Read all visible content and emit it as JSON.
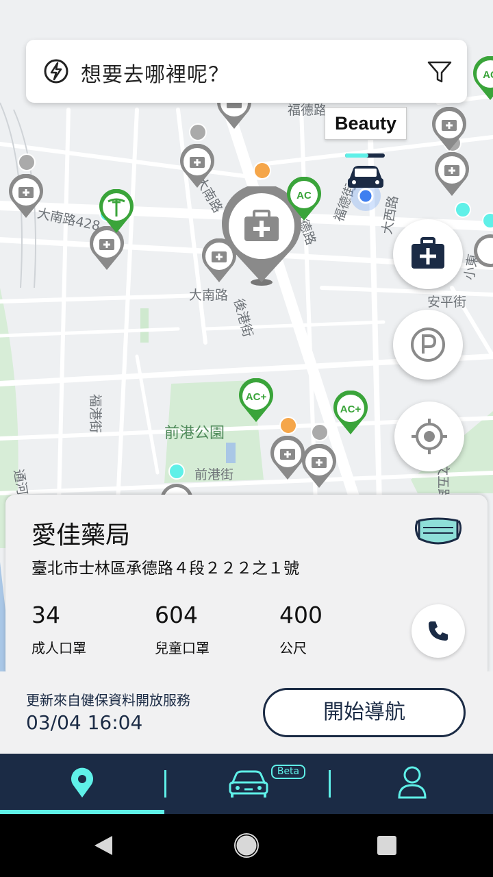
{
  "search": {
    "placeholder": "想要去哪裡呢？"
  },
  "map": {
    "streets": [
      "福德路",
      "大南路428",
      "大南路",
      "大南路",
      "後港街",
      "福德街",
      "大西路",
      "福港街",
      "前港街",
      "安平街",
      "小東",
      "通河",
      "文五路",
      "承德路"
    ],
    "park": "前港公園",
    "vehicle_label": "Beauty",
    "pin_labels": {
      "ac": "AC",
      "ac_plus": "AC+"
    }
  },
  "fabs": {
    "pharmacy": "pharmacy",
    "parking": "parking",
    "locate": "locate"
  },
  "store": {
    "name": "愛佳藥局",
    "address": "臺北市士林區承德路４段２２２之１號",
    "adult_masks": "34",
    "adult_masks_label": "成人口罩",
    "child_masks": "604",
    "child_masks_label": "兒童口罩",
    "distance": "400",
    "distance_label": "公尺"
  },
  "footer": {
    "update_label": "更新來自健保資料開放服務",
    "update_time": "03/04 16:04",
    "navigate_label": "開始導航"
  },
  "tabs": {
    "beta_badge": "Beta",
    "active": "map"
  },
  "colors": {
    "navy": "#1b2b45",
    "accent": "#5ff0e8",
    "green": "#3aa43a",
    "pin_grey": "#8a8a8a"
  }
}
